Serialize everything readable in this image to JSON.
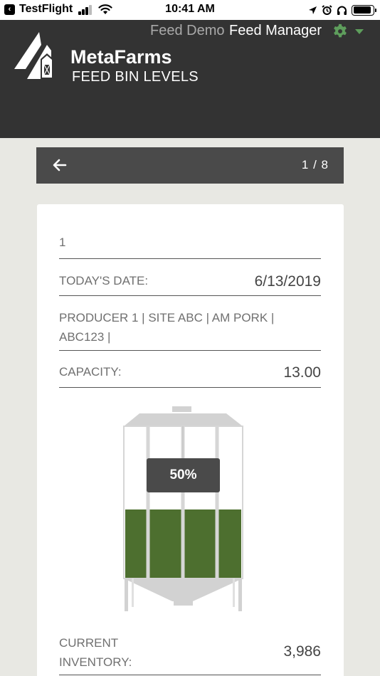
{
  "status_bar": {
    "back_app": "TestFlight",
    "time": "10:41 AM"
  },
  "header": {
    "nav_demo": "Feed Demo",
    "nav_manager": "Feed Manager",
    "brand": "MetaFarms",
    "subtitle": "FEED BIN LEVELS",
    "gear_color": "#5e9e5c"
  },
  "pager": {
    "position": "1 / 8"
  },
  "card": {
    "bin_id": "1",
    "date_label": "TODAY'S DATE:",
    "date_value": "6/13/2019",
    "location": "PRODUCER 1 | SITE ABC | AM PORK | ABC123 |",
    "capacity_label": "CAPACITY:",
    "capacity_value": "13.00",
    "fill_percent_label": "50%",
    "fill_fraction": 0.5,
    "fill_color": "#4d6f2f",
    "inventory_label": "CURRENT INVENTORY:",
    "inventory_value": "3,986"
  }
}
